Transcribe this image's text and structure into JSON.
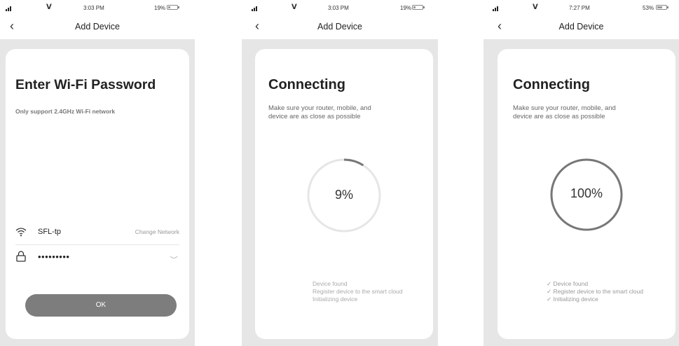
{
  "screens": [
    {
      "status": {
        "time": "3:03 PM",
        "battery": "19%",
        "battery_level": 0.19
      },
      "nav": {
        "title": "Add Device"
      },
      "card": {
        "title": "Enter Wi-Fi Password",
        "subtitle": "Only support 2.4GHz Wi-Fi network",
        "network_name": "SFL-tp",
        "change_network": "Change Network",
        "password_masked": "•••••••••",
        "ok_label": "OK"
      }
    },
    {
      "status": {
        "time": "3:03 PM",
        "battery": "19%",
        "battery_level": 0.19
      },
      "nav": {
        "title": "Add Device"
      },
      "card": {
        "title": "Connecting",
        "subtitle_line1": "Make sure your router, mobile, and",
        "subtitle_line2": "device are as close as possible",
        "percent": "9%",
        "progress": 0.09,
        "steps": [
          "Device found",
          "Register device to the smart cloud",
          "Initializing device"
        ]
      }
    },
    {
      "status": {
        "time": "7:27 PM",
        "battery": "53%",
        "battery_level": 0.53
      },
      "nav": {
        "title": "Add Device"
      },
      "card": {
        "title": "Connecting",
        "subtitle_line1": "Make sure your router, mobile, and",
        "subtitle_line2": "device are as close as possible",
        "percent": "100%",
        "progress": 1.0,
        "steps": [
          "✓ Device found",
          "✓ Register device to the smart cloud",
          "✓ Initializing device"
        ]
      }
    }
  ],
  "icons": {
    "back": "back-chevron-icon",
    "wifi": "wifi-icon",
    "lock": "lock-icon",
    "eye": "eye-closed-icon",
    "signal": "signal-bars-icon",
    "battery": "battery-icon"
  },
  "colors": {
    "background": "#e6e6e6",
    "card": "#ffffff",
    "button": "#7d7d7d",
    "ring_track": "#e6e6e6",
    "ring_progress": "#777777"
  }
}
